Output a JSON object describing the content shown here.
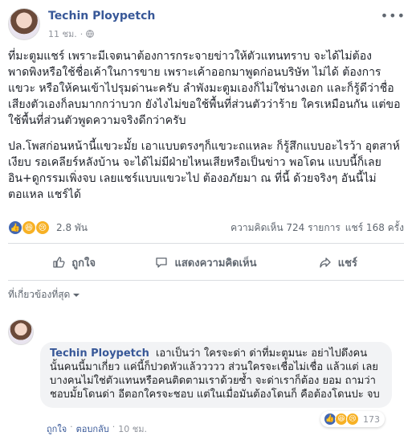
{
  "post": {
    "author": "Techin Ploypetch",
    "time": "11 ชม.",
    "more_label": "•••",
    "paragraphs": [
      "ที่มะตูมแชร์ เพราะมีเจตนาต้องการกระจายข่าวให้ตัวแทนทราบ จะได้ไม่ต้อง พาดพิงหรือใช้ชื่อเค้าในการขาย เพราะเค้าออกมาพูดก่อนบริษัท ไม่ได้ ต้องการแขวะ หรือให้คนเข้าไปรุมด่านะครับ ลำพังมะตูมเองก็ไม่ใช่นางเอก และก็รู้ดีว่าชื่อเสียงตัวเองก็ลบมากกว่าบวก ยังไงไม่ขอใช้พื้นที่ส่วนตัวว่าร้าย ใครเหมือนกัน แต่ขอใช้พื้นที่ส่วนตัวพูดความจริงดีกว่าครับ",
      "ปล.โพสก่อนหน้านี้แขวะมั้ย เอาแบบตรงๆก็แขวะถแหละ ก็รู้สึกแบบอะไรว้า อุตสาห์เงียบ รอเคลียร์หลังบ้าน จะได้ไม่มีฝ่ายไหนเสียหรือเป็นข่าว พอโดน แบบนี้ก็เลยอิน+ดูกรรมเพิ่งจบ เลยแชร์แบบแขวะไป ต้องอภัยมา ณ ที่นี้ ด้วยจริงๆ อันนี้ไม่ตอแหล แชร์ได้"
    ],
    "reactions_count": "2.8 พัน",
    "comments_count": "ความคิดเห็น 724 รายการ",
    "shares_count": "แชร์ 168 ครั้ง"
  },
  "actions": {
    "like": "ถูกใจ",
    "comment": "แสดงความคิดเห็น",
    "share": "แชร์"
  },
  "relevance_label": "ที่เกี่ยวข้องที่สุด",
  "comment": {
    "author": "Techin Ploypetch",
    "text": "เอาเป็นว่า ใครจะด่า ด่าที่มะตูมนะ อย่าไปดึงคน นั้นคนนี้มาเกี่ยว แค่นี้ก็ปวดหัวแล้ววววว ส่วนใครจะเชื่อไม่เชื่อ แล้วแต่ เลย บางคนไม่ใช่ตัวแทนหรือคนติดตามเราด้วยซ้ำ จะด่าเราก็ต้อง ยอม ถามว่าชอบมั้ยโดนด่า อีตอกใครจะชอบ แต่ในเมื่อมันต้องโดนก็ คือต้องโดนปะ จบ",
    "like_link": "ถูกใจ",
    "reply_link": "ตอบกลับ",
    "time": "10 ชม.",
    "reactions_count": "173"
  },
  "colors": {
    "link": "#385898",
    "like_blue": "#4267b2",
    "haha_yellow": "#f7b125"
  },
  "icons": [
    "globe-icon",
    "like-reaction-icon",
    "haha-reaction-icon",
    "sad-reaction-icon",
    "thumbs-up-icon",
    "comment-icon",
    "share-icon",
    "chevron-down-icon"
  ]
}
